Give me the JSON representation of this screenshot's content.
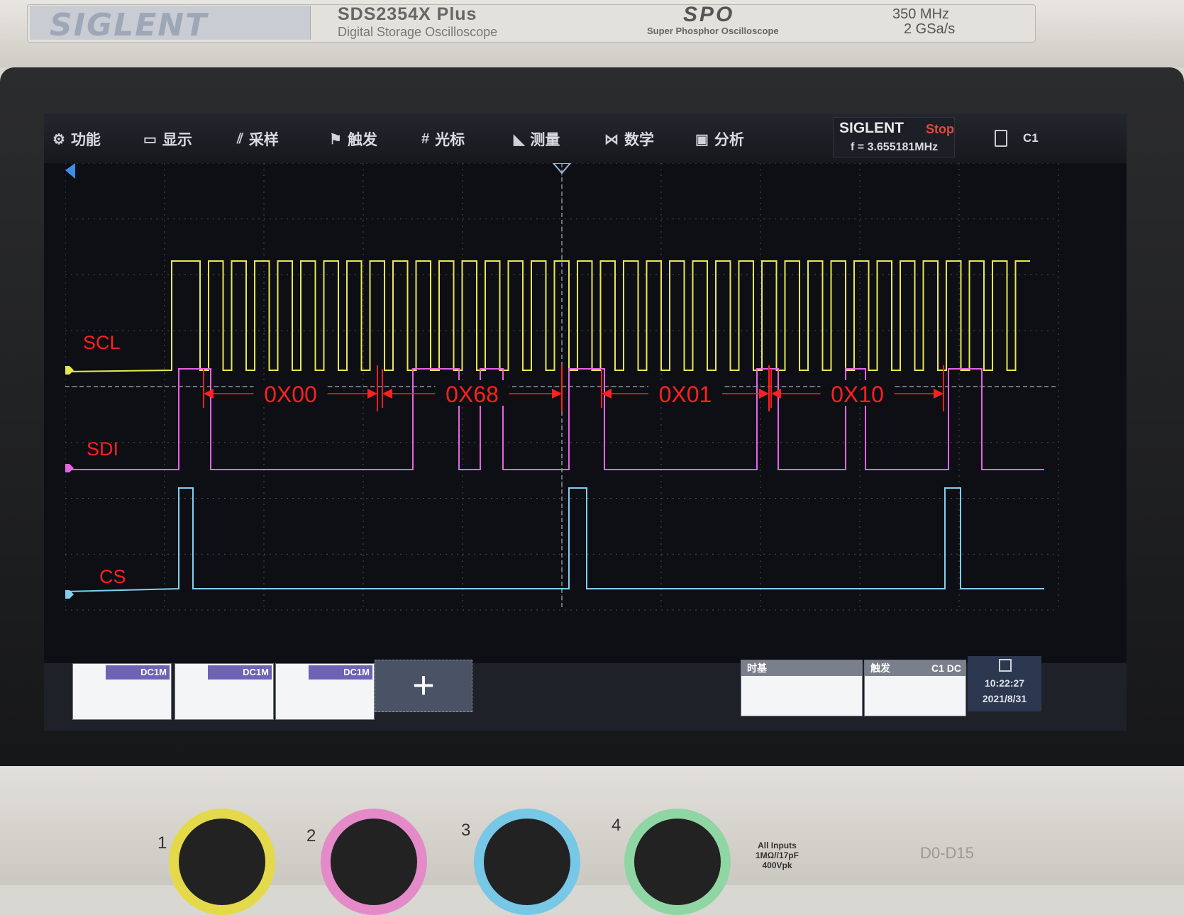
{
  "device": {
    "brand": "SIGLENT",
    "model": "SDS2354X  Plus",
    "model_subtitle": "Digital Storage Oscilloscope",
    "tech_logo": "SPO",
    "tech_subtitle": "Super Phosphor Oscilloscope",
    "bandwidth": "350 MHz",
    "sample_rate": "2 GSa/s"
  },
  "menu": {
    "items": [
      {
        "icon": "⚙",
        "label": "功能"
      },
      {
        "icon": "▭",
        "label": "显示"
      },
      {
        "icon": "⫽",
        "label": "采样"
      },
      {
        "icon": "⚑",
        "label": "触发"
      },
      {
        "icon": "#",
        "label": "光标"
      },
      {
        "icon": "◣",
        "label": "测量"
      },
      {
        "icon": "⋈",
        "label": "数学"
      },
      {
        "icon": "▣",
        "label": "分析"
      }
    ]
  },
  "status": {
    "brand": "SIGLENT",
    "run_state": "Stop",
    "frequency": "f = 3.655181MHz",
    "trigger_source": "C1"
  },
  "channels": {
    "labels": [
      "SCL",
      "SDI",
      "CS"
    ],
    "colors": {
      "scl": "#e8e74f",
      "sdi": "#e663e6",
      "cs": "#7fd0f0",
      "annotation": "#ff2020"
    }
  },
  "annotations": {
    "segments": [
      "0X00",
      "0X68",
      "0X01",
      "0X10"
    ]
  },
  "bottom": {
    "ch1_coupling": "DC1M",
    "ch2_coupling": "DC1M",
    "ch3_coupling": "DC1M",
    "add_symbol": "+",
    "timebase_title": "时基",
    "trigger_title": "触发",
    "trigger_tag": "C1 DC",
    "time": "10:22:27",
    "date": "2021/8/31"
  },
  "panel": {
    "bnc_numbers": [
      "1",
      "2",
      "3",
      "4"
    ],
    "inputs_line1": "All Inputs",
    "inputs_line2": "1MΩ//17pF",
    "inputs_line3": "400Vpk",
    "digital": "D0-D15"
  }
}
